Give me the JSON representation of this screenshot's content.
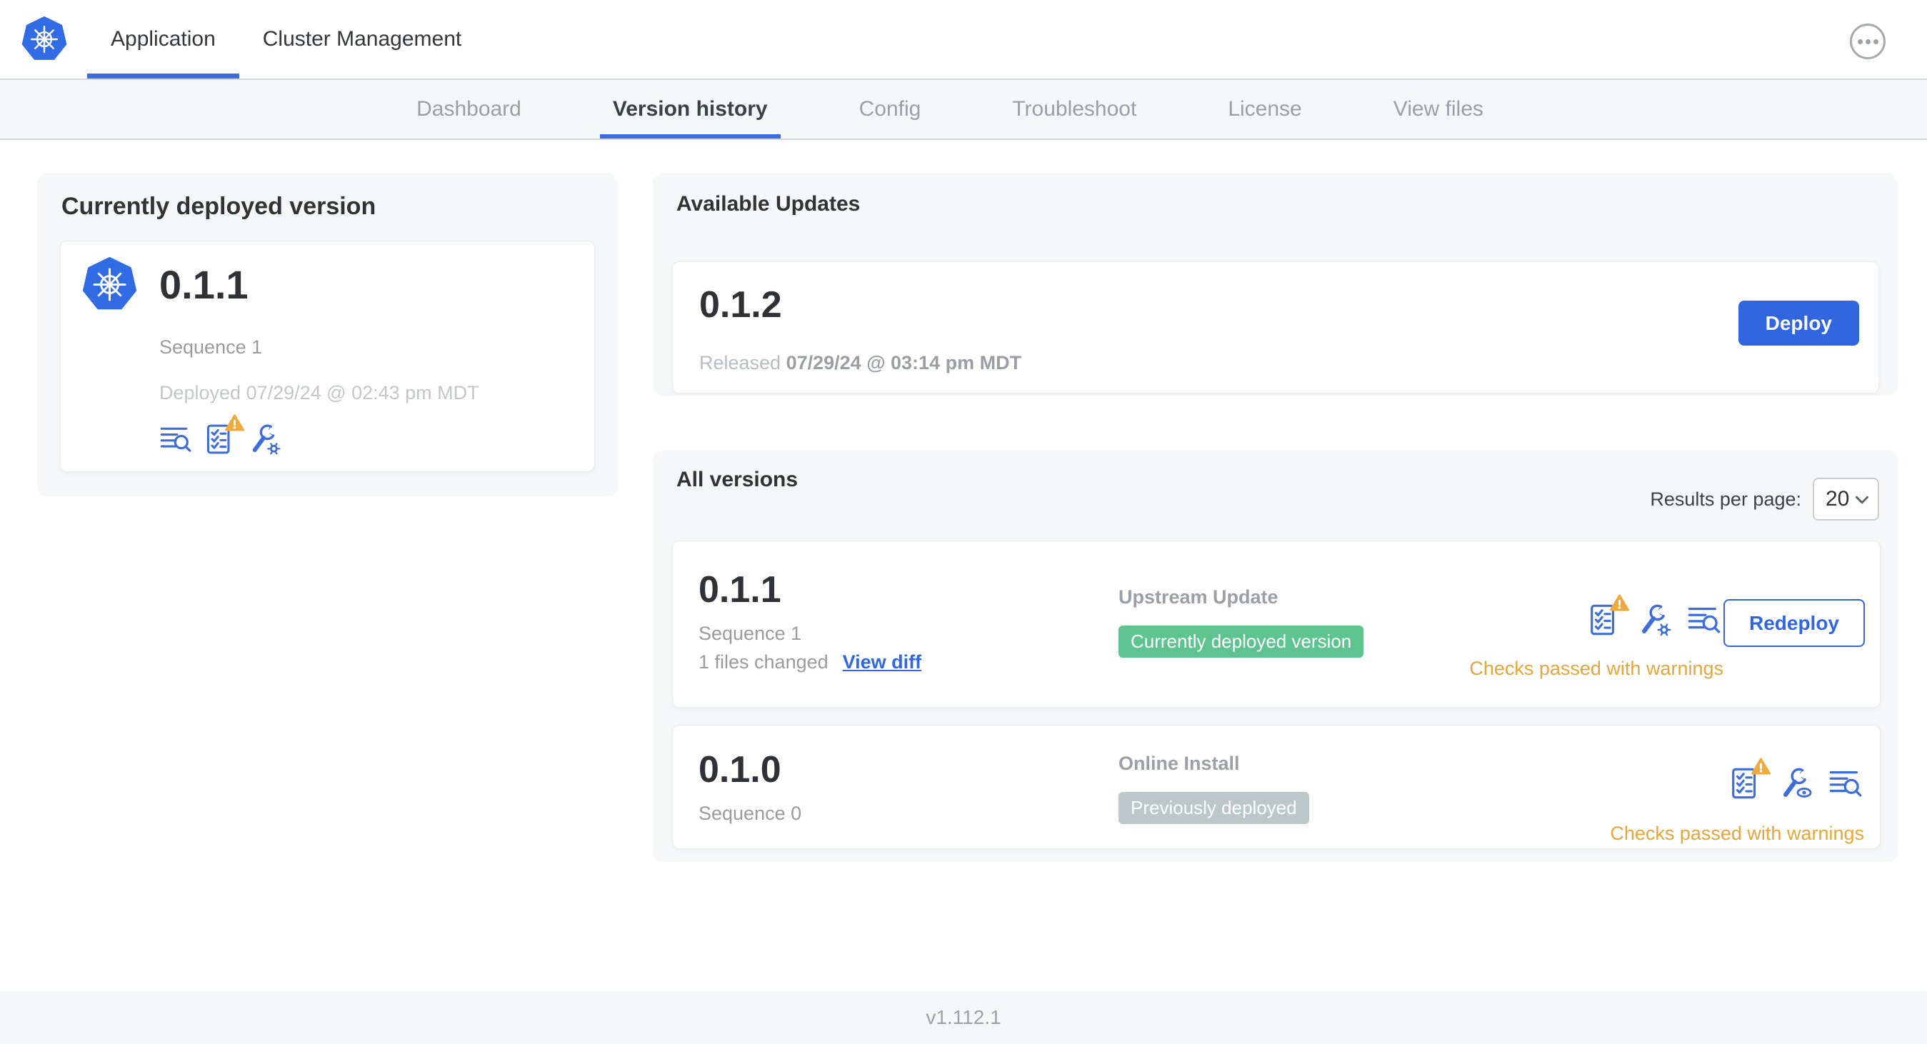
{
  "header": {
    "tabs": [
      {
        "label": "Application"
      },
      {
        "label": "Cluster Management"
      }
    ]
  },
  "subnav": {
    "items": [
      {
        "label": "Dashboard"
      },
      {
        "label": "Version history"
      },
      {
        "label": "Config"
      },
      {
        "label": "Troubleshoot"
      },
      {
        "label": "License"
      },
      {
        "label": "View files"
      }
    ]
  },
  "currently_deployed": {
    "title": "Currently deployed version",
    "version": "0.1.1",
    "sequence": "Sequence 1",
    "deployed_at": "Deployed 07/29/24 @ 02:43 pm MDT"
  },
  "available_updates": {
    "title": "Available Updates",
    "version": "0.1.2",
    "released_prefix": "Released",
    "released_at": "07/29/24 @ 03:14 pm MDT",
    "deploy_label": "Deploy"
  },
  "all_versions": {
    "title": "All versions",
    "results_per_page_label": "Results per page:",
    "results_per_page_value": "20",
    "rows": [
      {
        "version": "0.1.1",
        "sequence": "Sequence 1",
        "files_changed": "1 files changed",
        "view_diff_label": "View diff",
        "source": "Upstream Update",
        "status_badge": "Currently deployed version",
        "checks_text": "Checks passed with warnings",
        "action_label": "Redeploy"
      },
      {
        "version": "0.1.0",
        "sequence": "Sequence 0",
        "source": "Online Install",
        "status_badge": "Previously deployed",
        "checks_text": "Checks passed with warnings"
      }
    ]
  },
  "footer": {
    "app_version": "v1.112.1"
  },
  "colors": {
    "primary_blue": "#3066e0",
    "icon_blue": "#3d6ddb",
    "kubernetes_blue": "#326ce5",
    "badge_green": "#5dc38f",
    "badge_gray": "#bcc7c9",
    "warning_orange": "#e6a639",
    "card_gray": "#f5f8f9"
  }
}
